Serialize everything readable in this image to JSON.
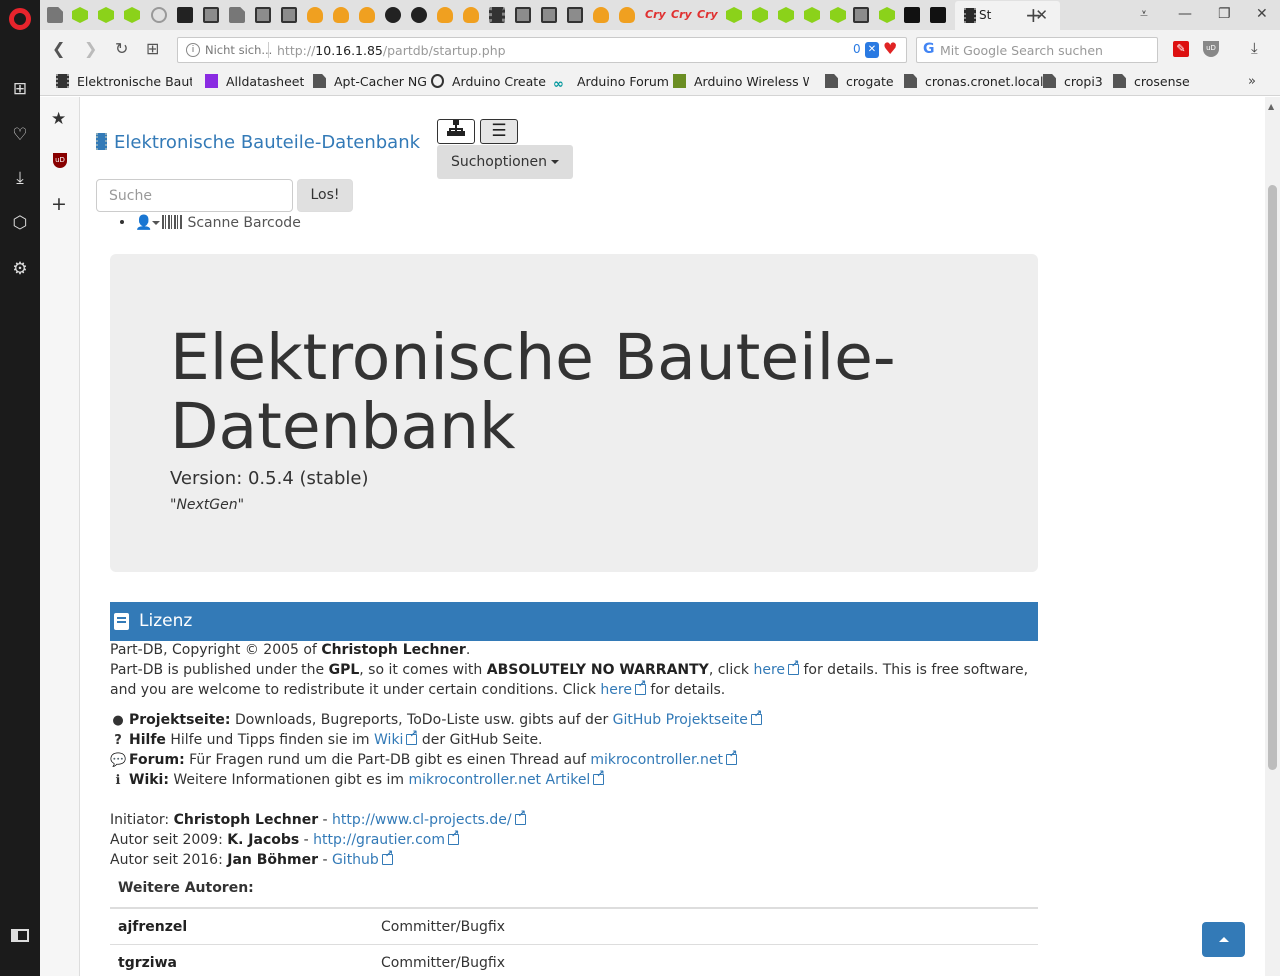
{
  "browser": {
    "active_tab_title": "St",
    "security_label": "Nicht sich...",
    "url_prefix": "http://",
    "url_host": "10.16.1.85",
    "url_path": "/partdb/startup.php",
    "tracker_count": "0",
    "search_placeholder": "Mit Google Search suchen",
    "bookmarks": [
      "Elektronische Baute",
      "Alldatasheet",
      "Apt-Cacher NG",
      "Arduino Create",
      "Arduino Forum",
      "Arduino Wireless W",
      "crogate",
      "cronas.cronet.local",
      "cropi3",
      "crosense"
    ]
  },
  "page": {
    "brand": "Elektronische Bauteile-Datenbank",
    "search_options_label": "Suchoptionen",
    "search_placeholder": "Suche",
    "search_button": "Los!",
    "scan_barcode": "Scanne Barcode",
    "jumbotron": {
      "title": "Elektronische Bauteile-Datenbank",
      "version": "Version: 0.5.4 (stable)",
      "codename": "\"NextGen\""
    },
    "license": {
      "header": "Lizenz",
      "copyright_pre": "Part-DB, Copyright © 2005 of ",
      "copyright_name": "Christoph Lechner",
      "copyright_post": ".",
      "gpl_1": "Part-DB is published under the ",
      "gpl_bold": "GPL",
      "gpl_2": ", so it comes with ",
      "gpl_warranty": "ABSOLUTELY NO WARRANTY",
      "gpl_3": ", click ",
      "gpl_link1": "here",
      "gpl_4": " for details. This is free software,",
      "gpl_5": "and you are welcome to redistribute it under certain conditions. Click ",
      "gpl_link2": "here",
      "gpl_6": " for details."
    },
    "info": [
      {
        "label": "Projektseite:",
        "text": " Downloads, Bugreports, ToDo-Liste usw. gibts auf der ",
        "link": "GitHub Projektseite",
        "after": ""
      },
      {
        "label": "Hilfe",
        "text": " Hilfe und Tipps finden sie im ",
        "link": "Wiki",
        "after": " der GitHub Seite."
      },
      {
        "label": "Forum:",
        "text": " Für Fragen rund um die Part-DB gibt es einen Thread auf ",
        "link": "mikrocontroller.net",
        "after": ""
      },
      {
        "label": "Wiki:",
        "text": " Weitere Informationen gibt es im ",
        "link": "mikrocontroller.net Artikel",
        "after": ""
      }
    ],
    "credits": [
      {
        "role": "Initiator: ",
        "name": "Christoph Lechner",
        "sep": " - ",
        "link": "http://www.cl-projects.de/"
      },
      {
        "role": "Autor seit 2009: ",
        "name": "K. Jacobs",
        "sep": " - ",
        "link": "http://grautier.com"
      },
      {
        "role": "Autor seit 2016: ",
        "name": "Jan Böhmer",
        "sep": " - ",
        "link": "Github"
      }
    ],
    "authors_header": "Weitere Autoren:",
    "authors": [
      {
        "name": "ajfrenzel",
        "role": "Committer/Bugfix"
      },
      {
        "name": "tgrziwa",
        "role": "Committer/Bugfix"
      }
    ]
  }
}
